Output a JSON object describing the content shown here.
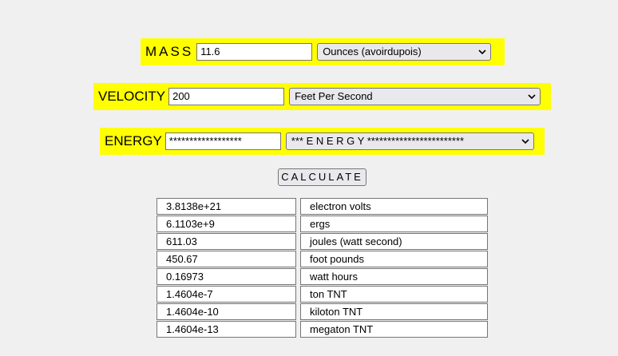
{
  "mass": {
    "label": "MASS",
    "value": "11.6",
    "unit_selected": "Ounces (avoirdupois)"
  },
  "velocity": {
    "label": "VELOCITY",
    "value": "200",
    "unit_selected": "Feet Per Second"
  },
  "energy": {
    "label": "ENERGY",
    "value": "******************",
    "unit_selected": "*** E N E R G Y ************************"
  },
  "calculate_label": "CALCULATE",
  "results": [
    {
      "value": "3.8138e+21",
      "unit": "electron volts"
    },
    {
      "value": "6.1103e+9",
      "unit": "ergs"
    },
    {
      "value": "611.03",
      "unit": "joules (watt second)"
    },
    {
      "value": "450.67",
      "unit": "foot pounds"
    },
    {
      "value": "0.16973",
      "unit": "watt hours"
    },
    {
      "value": "1.4604e-7",
      "unit": "ton TNT"
    },
    {
      "value": "1.4604e-10",
      "unit": "kiloton TNT"
    },
    {
      "value": "1.4604e-13",
      "unit": "megaton TNT"
    }
  ]
}
